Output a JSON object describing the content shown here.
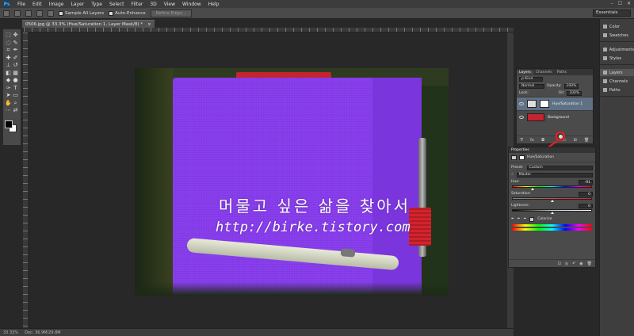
{
  "app": {
    "logo": "Ps"
  },
  "menu": [
    "File",
    "Edit",
    "Image",
    "Layer",
    "Type",
    "Select",
    "Filter",
    "3D",
    "View",
    "Window",
    "Help"
  ],
  "window_controls": [
    "–",
    "☐",
    "✕"
  ],
  "options_bar": {
    "sample_all_layers": "Sample All Layers",
    "auto_enhance": "Auto-Enhance",
    "refine_edge": "Refine Edge...",
    "workspace": "Essentials"
  },
  "document": {
    "tab_title": "0506.jpg @ 33.3% (Hue/Saturation 1, Layer Mask/8) *",
    "close": "×"
  },
  "watermark": {
    "korean": "머물고 싶은 삶을 찾아서",
    "url": "http://birke.tistory.com"
  },
  "status": {
    "zoom": "33.33%",
    "doc": "Doc: 36.9M/29.8M"
  },
  "right_panels": {
    "group1": [
      "Color",
      "Swatches"
    ],
    "group2": [
      "Adjustments",
      "Styles"
    ],
    "group3": [
      "Layers",
      "Channels",
      "Paths"
    ]
  },
  "layers_panel": {
    "tabs": [
      "Layers",
      "Channels",
      "Paths"
    ],
    "kind": "ρ Kind",
    "blend_mode": "Normal",
    "opacity_label": "Opacity:",
    "opacity": "100%",
    "lock_label": "Lock:",
    "fill_label": "Fill:",
    "fill": "100%",
    "layers": [
      {
        "name": "Hue/Saturation 1"
      },
      {
        "name": "Background"
      }
    ],
    "footer": [
      "ᐁ",
      "fx",
      "◘",
      "◐",
      "▭",
      "⊞",
      "🗑"
    ]
  },
  "properties_panel": {
    "header": "Properties",
    "title": "Hue/Saturation",
    "preset_label": "Preset:",
    "preset": "Custom",
    "channel": "Master",
    "hue_label": "Hue:",
    "hue": "-91",
    "saturation_label": "Saturation:",
    "saturation": "0",
    "lightness_label": "Lightness:",
    "lightness": "0",
    "colorize_label": "Colorize",
    "footer": [
      "⊡",
      "◎",
      "↶",
      "◉",
      "🗑"
    ]
  },
  "colors": {
    "accent_red": "#ff1a1a",
    "book_purple": "#8a3ff0"
  }
}
